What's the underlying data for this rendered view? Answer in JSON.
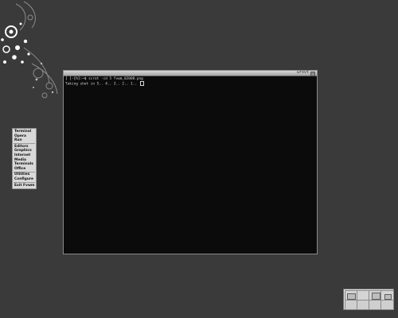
{
  "terminal": {
    "title": "urxvt",
    "lines": [
      {
        "prompt": "[ ]-[h]:~$",
        "text": " scrot -cd 5 fvwm_02008.png"
      },
      {
        "prompt": "",
        "text": "Taking shot in 5.. 4.. 3.. 2.. 1.. "
      }
    ]
  },
  "menu": {
    "items": [
      "Terminal",
      "Opera",
      "Run",
      "Editors",
      "Graphics",
      "Internet",
      "Media",
      "Terminals",
      "Office",
      "Utilities",
      "Configure",
      "Exit Fvwm"
    ]
  },
  "pager": {
    "desktops": 4
  },
  "colors": {
    "desktop": "#3a3a3a",
    "terminal_bg": "#0b0b0b",
    "menu_bg": "#d9d9d9"
  }
}
